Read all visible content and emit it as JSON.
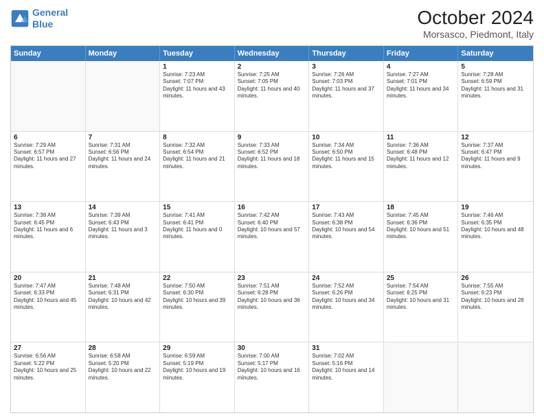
{
  "logo": {
    "line1": "General",
    "line2": "Blue"
  },
  "title": "October 2024",
  "subtitle": "Morsasco, Piedmont, Italy",
  "days": [
    "Sunday",
    "Monday",
    "Tuesday",
    "Wednesday",
    "Thursday",
    "Friday",
    "Saturday"
  ],
  "weeks": [
    [
      {
        "day": "",
        "text": ""
      },
      {
        "day": "",
        "text": ""
      },
      {
        "day": "1",
        "text": "Sunrise: 7:23 AM\nSunset: 7:07 PM\nDaylight: 11 hours and 43 minutes."
      },
      {
        "day": "2",
        "text": "Sunrise: 7:25 AM\nSunset: 7:05 PM\nDaylight: 11 hours and 40 minutes."
      },
      {
        "day": "3",
        "text": "Sunrise: 7:26 AM\nSunset: 7:03 PM\nDaylight: 11 hours and 37 minutes."
      },
      {
        "day": "4",
        "text": "Sunrise: 7:27 AM\nSunset: 7:01 PM\nDaylight: 11 hours and 34 minutes."
      },
      {
        "day": "5",
        "text": "Sunrise: 7:28 AM\nSunset: 6:59 PM\nDaylight: 11 hours and 31 minutes."
      }
    ],
    [
      {
        "day": "6",
        "text": "Sunrise: 7:29 AM\nSunset: 6:57 PM\nDaylight: 11 hours and 27 minutes."
      },
      {
        "day": "7",
        "text": "Sunrise: 7:31 AM\nSunset: 6:56 PM\nDaylight: 11 hours and 24 minutes."
      },
      {
        "day": "8",
        "text": "Sunrise: 7:32 AM\nSunset: 6:54 PM\nDaylight: 11 hours and 21 minutes."
      },
      {
        "day": "9",
        "text": "Sunrise: 7:33 AM\nSunset: 6:52 PM\nDaylight: 11 hours and 18 minutes."
      },
      {
        "day": "10",
        "text": "Sunrise: 7:34 AM\nSunset: 6:50 PM\nDaylight: 11 hours and 15 minutes."
      },
      {
        "day": "11",
        "text": "Sunrise: 7:36 AM\nSunset: 6:48 PM\nDaylight: 11 hours and 12 minutes."
      },
      {
        "day": "12",
        "text": "Sunrise: 7:37 AM\nSunset: 6:47 PM\nDaylight: 11 hours and 9 minutes."
      }
    ],
    [
      {
        "day": "13",
        "text": "Sunrise: 7:38 AM\nSunset: 6:45 PM\nDaylight: 11 hours and 6 minutes."
      },
      {
        "day": "14",
        "text": "Sunrise: 7:39 AM\nSunset: 6:43 PM\nDaylight: 11 hours and 3 minutes."
      },
      {
        "day": "15",
        "text": "Sunrise: 7:41 AM\nSunset: 6:41 PM\nDaylight: 11 hours and 0 minutes."
      },
      {
        "day": "16",
        "text": "Sunrise: 7:42 AM\nSunset: 6:40 PM\nDaylight: 10 hours and 57 minutes."
      },
      {
        "day": "17",
        "text": "Sunrise: 7:43 AM\nSunset: 6:38 PM\nDaylight: 10 hours and 54 minutes."
      },
      {
        "day": "18",
        "text": "Sunrise: 7:45 AM\nSunset: 6:36 PM\nDaylight: 10 hours and 51 minutes."
      },
      {
        "day": "19",
        "text": "Sunrise: 7:46 AM\nSunset: 6:35 PM\nDaylight: 10 hours and 48 minutes."
      }
    ],
    [
      {
        "day": "20",
        "text": "Sunrise: 7:47 AM\nSunset: 6:33 PM\nDaylight: 10 hours and 45 minutes."
      },
      {
        "day": "21",
        "text": "Sunrise: 7:48 AM\nSunset: 6:31 PM\nDaylight: 10 hours and 42 minutes."
      },
      {
        "day": "22",
        "text": "Sunrise: 7:50 AM\nSunset: 6:30 PM\nDaylight: 10 hours and 39 minutes."
      },
      {
        "day": "23",
        "text": "Sunrise: 7:51 AM\nSunset: 6:28 PM\nDaylight: 10 hours and 36 minutes."
      },
      {
        "day": "24",
        "text": "Sunrise: 7:52 AM\nSunset: 6:26 PM\nDaylight: 10 hours and 34 minutes."
      },
      {
        "day": "25",
        "text": "Sunrise: 7:54 AM\nSunset: 6:25 PM\nDaylight: 10 hours and 31 minutes."
      },
      {
        "day": "26",
        "text": "Sunrise: 7:55 AM\nSunset: 6:23 PM\nDaylight: 10 hours and 28 minutes."
      }
    ],
    [
      {
        "day": "27",
        "text": "Sunrise: 6:56 AM\nSunset: 5:22 PM\nDaylight: 10 hours and 25 minutes."
      },
      {
        "day": "28",
        "text": "Sunrise: 6:58 AM\nSunset: 5:20 PM\nDaylight: 10 hours and 22 minutes."
      },
      {
        "day": "29",
        "text": "Sunrise: 6:59 AM\nSunset: 5:19 PM\nDaylight: 10 hours and 19 minutes."
      },
      {
        "day": "30",
        "text": "Sunrise: 7:00 AM\nSunset: 5:17 PM\nDaylight: 10 hours and 16 minutes."
      },
      {
        "day": "31",
        "text": "Sunrise: 7:02 AM\nSunset: 5:16 PM\nDaylight: 10 hours and 14 minutes."
      },
      {
        "day": "",
        "text": ""
      },
      {
        "day": "",
        "text": ""
      }
    ]
  ]
}
